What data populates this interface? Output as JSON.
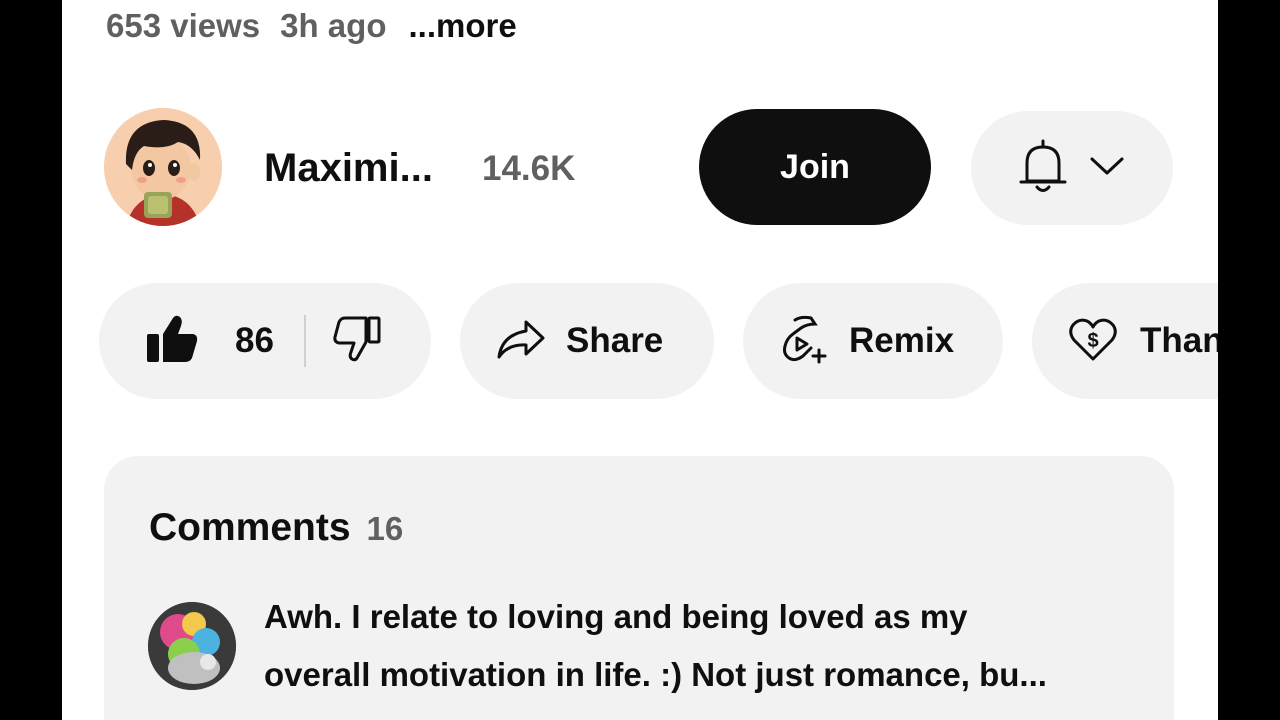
{
  "video_meta": {
    "views": "653 views",
    "age": "3h ago",
    "more_label": "...more"
  },
  "channel": {
    "name": "Maximi...",
    "subscribers": "14.6K",
    "join_label": "Join",
    "bell_icon": "bell-icon",
    "dropdown_icon": "chevron-down-icon"
  },
  "actions": {
    "like_count": "86",
    "share_label": "Share",
    "remix_label": "Remix",
    "thanks_label": "Than"
  },
  "comments": {
    "title": "Comments",
    "count": "16",
    "top_comment": {
      "line1": "Awh. I relate to loving and being loved as my",
      "line2": "overall motivation in life. :) Not just romance, bu..."
    }
  },
  "colors": {
    "background": "#ffffff",
    "pill_background": "#f2f2f2",
    "primary_text": "#0f0f0f",
    "secondary_text": "#606060",
    "join_button": "#0f0f0f"
  }
}
